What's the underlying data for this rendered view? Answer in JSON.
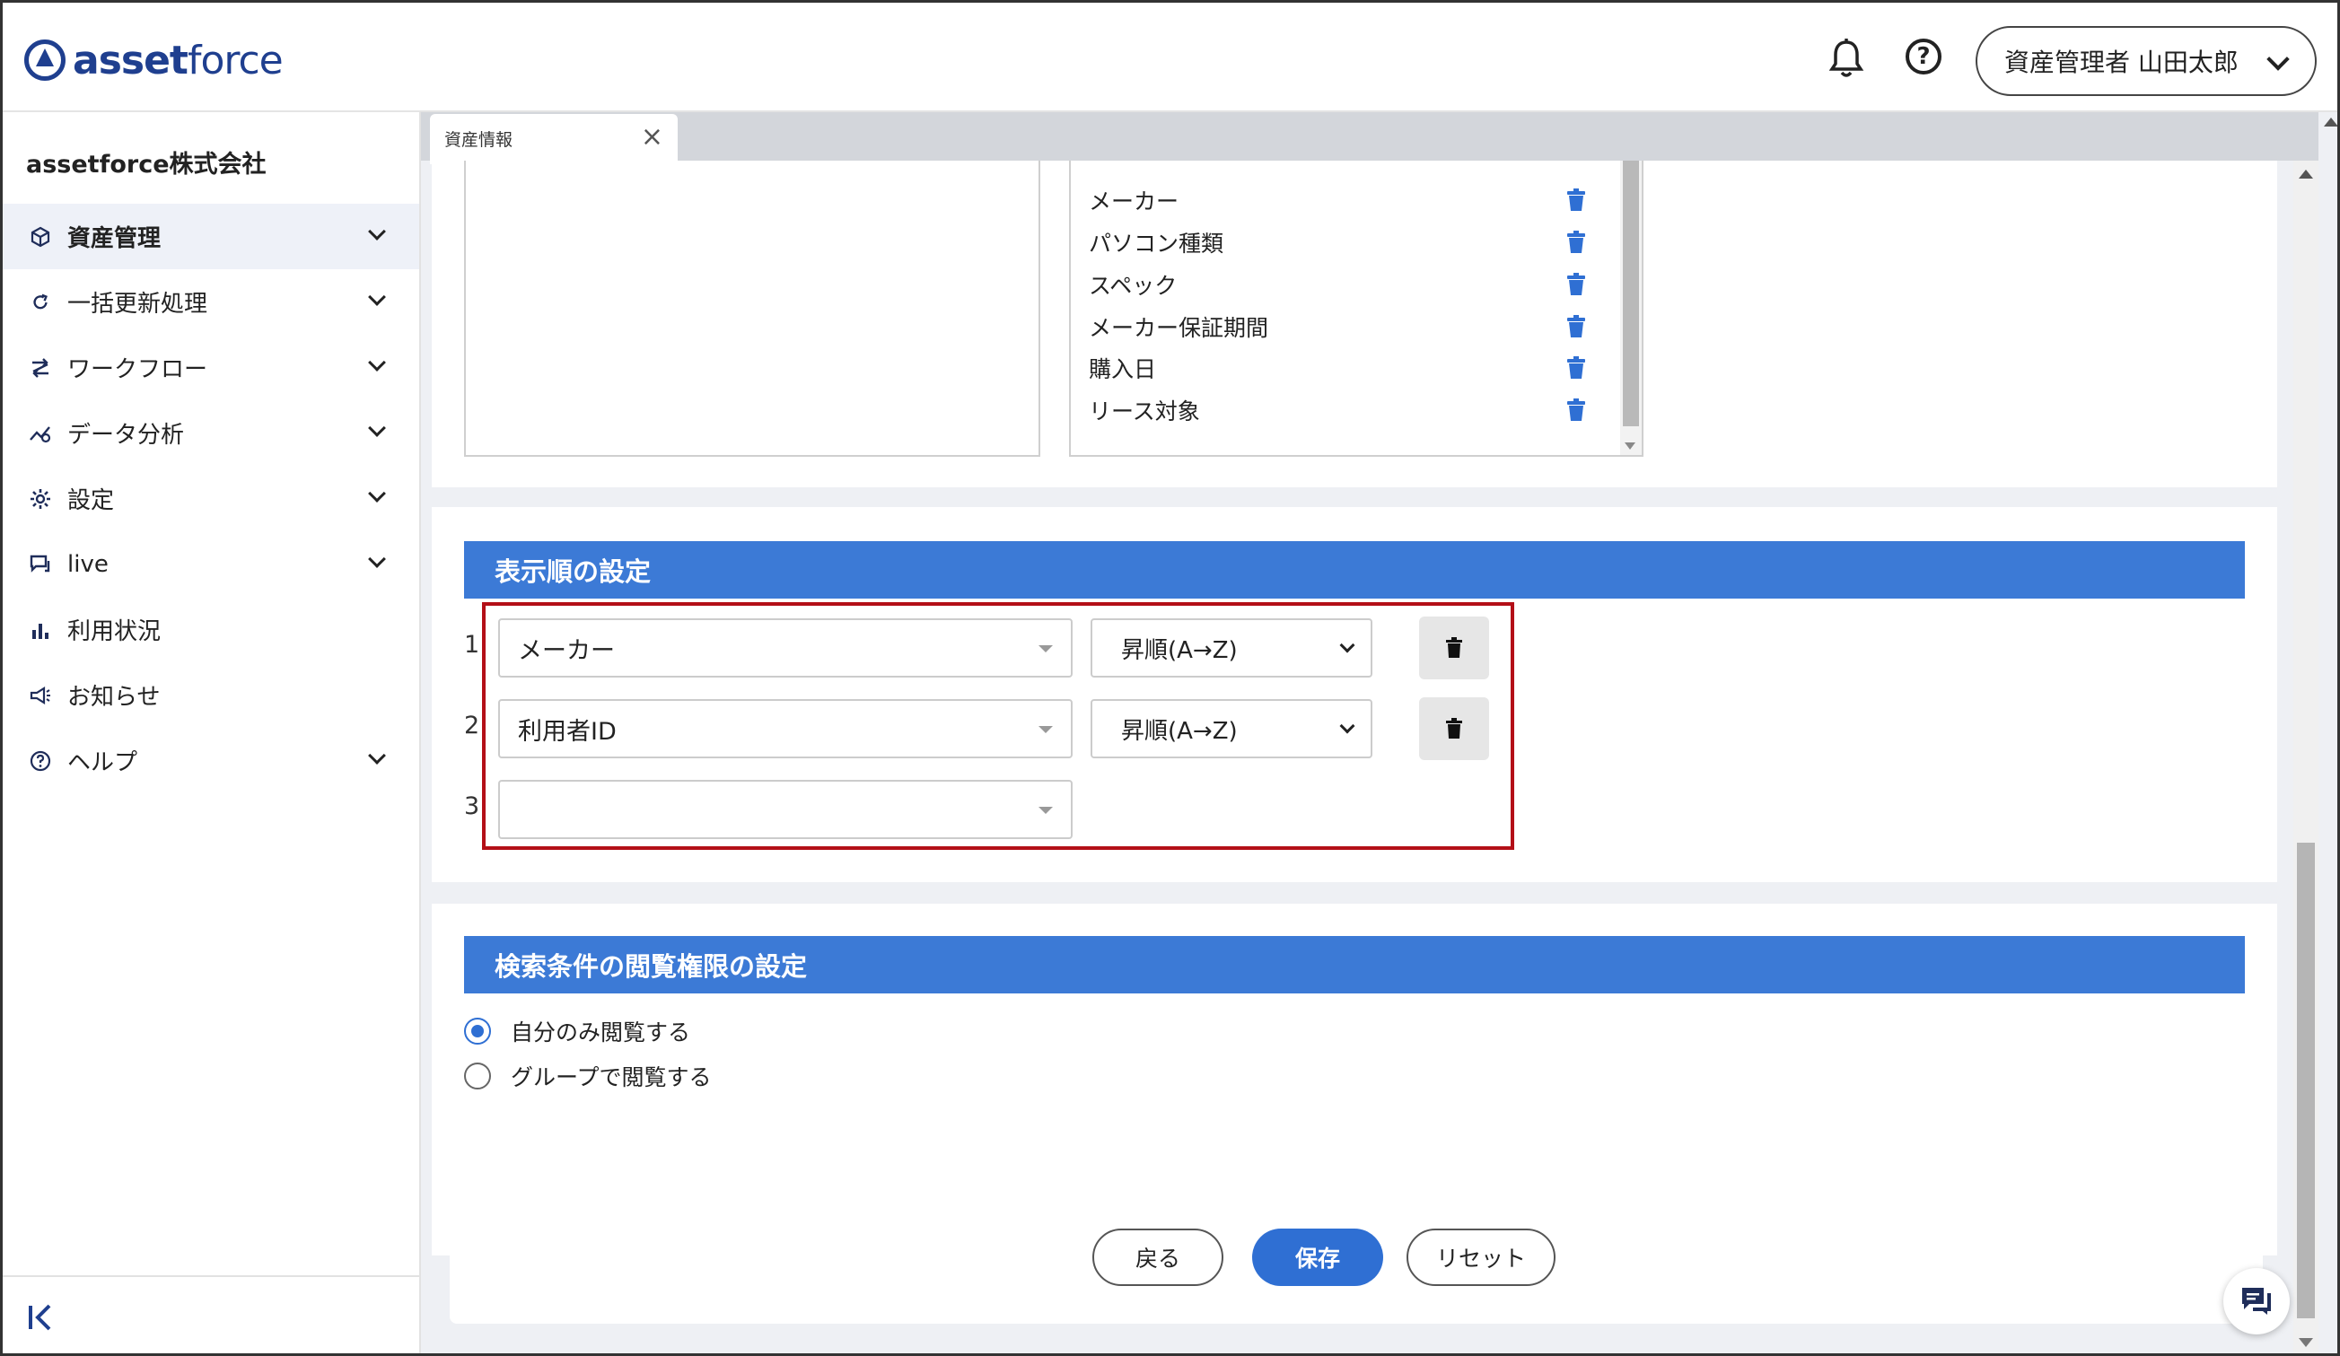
{
  "brand": {
    "logo_bold": "asset",
    "logo_light": "force"
  },
  "header": {
    "notification_icon": "bell-icon",
    "help_icon": "question-circle-icon",
    "help_glyph": "?",
    "user_label": "資産管理者 山田太郎"
  },
  "sidebar": {
    "company": "assetforce株式会社",
    "items": [
      {
        "label": "資産管理",
        "icon": "cube-icon",
        "has_children": true,
        "active": true
      },
      {
        "label": "一括更新処理",
        "icon": "refresh-icon",
        "has_children": true
      },
      {
        "label": "ワークフロー",
        "icon": "workflow-icon",
        "has_children": true
      },
      {
        "label": "データ分析",
        "icon": "analytics-icon",
        "has_children": true
      },
      {
        "label": "設定",
        "icon": "gear-icon",
        "has_children": true
      },
      {
        "label": "live",
        "icon": "chat-icon",
        "has_children": true
      },
      {
        "label": "利用状況",
        "icon": "bar-chart-icon",
        "has_children": false
      },
      {
        "label": "お知らせ",
        "icon": "megaphone-icon",
        "has_children": false
      },
      {
        "label": "ヘルプ",
        "icon": "help-icon",
        "has_children": true
      }
    ],
    "collapse_icon": "collapse-left-icon"
  },
  "tabs": [
    {
      "label": "資産情報",
      "closable": true
    }
  ],
  "selected_fields": [
    "メーカー",
    "パソコン種類",
    "スペック",
    "メーカー保証期間",
    "購入日",
    "リース対象"
  ],
  "sort_section": {
    "title": "表示順の設定",
    "rows": [
      {
        "number": "1",
        "field": "メーカー",
        "order": "昇順(A→Z)"
      },
      {
        "number": "2",
        "field": "利用者ID",
        "order": "昇順(A→Z)"
      },
      {
        "number": "3",
        "field": "",
        "order": ""
      }
    ]
  },
  "permission_section": {
    "title": "検索条件の閲覧権限の設定",
    "options": [
      {
        "label": "自分のみ閲覧する",
        "selected": true
      },
      {
        "label": "グループで閲覧する",
        "selected": false
      }
    ]
  },
  "actions": {
    "back": "戻る",
    "save": "保存",
    "reset": "リセット"
  },
  "colors": {
    "accent": "#2f6fd3",
    "section_header": "#3c7ad6",
    "highlight_border": "#b30f17",
    "brand": "#1f3f8f"
  }
}
